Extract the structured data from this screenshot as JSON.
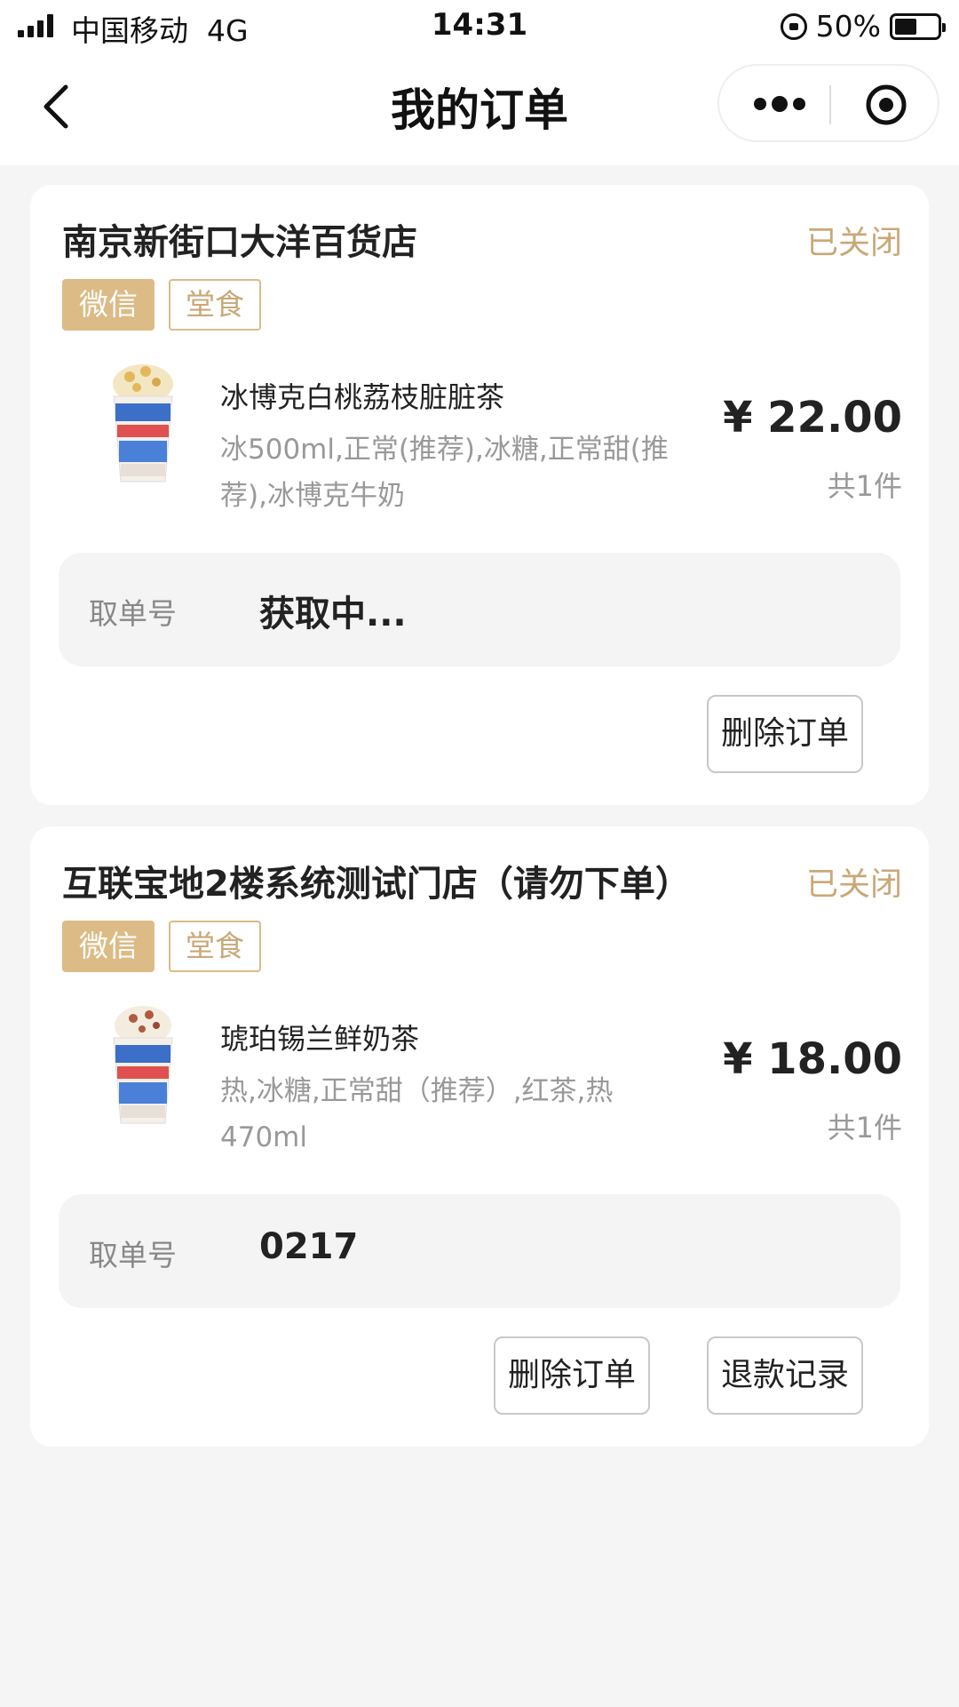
{
  "status_bar": {
    "carrier": "中国移动",
    "network": "4G",
    "time": "14:31",
    "battery_percent": "50%",
    "battery_level": 0.5
  },
  "nav": {
    "title": "我的订单",
    "back_icon": "chevron-left-icon",
    "more_icon": "more-dots-icon",
    "close_icon": "target-close-icon"
  },
  "colors": {
    "accent": "#c9a877",
    "tag_fill": "#dcbb86",
    "background": "#f5f5f5"
  },
  "orders": [
    {
      "store": "南京新街口大洋百货店",
      "status": "已关闭",
      "tags": [
        "微信",
        "堂食"
      ],
      "product": {
        "name": "冰博克白桃荔枝脏脏茶",
        "spec_line1": "冰500ml,正常(推荐),冰糖,正常甜(推",
        "spec_line2": "荐),冰博克牛奶",
        "price": "¥ 22.00",
        "qty": "共1件"
      },
      "pickup_label": "取单号",
      "pickup_value": "获取中...",
      "buttons": [
        "删除订单"
      ]
    },
    {
      "store": "互联宝地2楼系统测试门店（请勿下单）",
      "status": "已关闭",
      "tags": [
        "微信",
        "堂食"
      ],
      "product": {
        "name": "琥珀锡兰鲜奶茶",
        "spec_line1": "热,冰糖,正常甜（推荐）,红茶,热",
        "spec_line2": "470ml",
        "price": "¥ 18.00",
        "qty": "共1件"
      },
      "pickup_label": "取单号",
      "pickup_value": "0217",
      "buttons": [
        "删除订单",
        "退款记录"
      ]
    }
  ]
}
